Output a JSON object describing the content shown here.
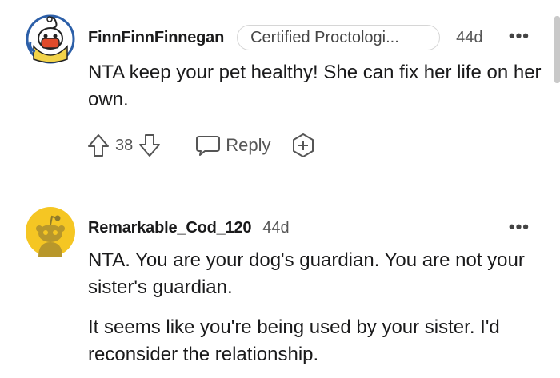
{
  "comments": [
    {
      "username": "FinnFinnFinnegan",
      "flair": "Certified Proctologi...",
      "age": "44d",
      "more_label": "•••",
      "body": [
        "NTA keep your pet healthy! She can fix her life on her own."
      ],
      "votes": "38",
      "reply_label": "Reply",
      "avatar_icon": "snoo-custom-avatar-icon"
    },
    {
      "username": "Remarkable_Cod_120",
      "age": "44d",
      "more_label": "•••",
      "body": [
        "NTA. You are your dog's guardian. You are not your sister's guardian.",
        "It seems like you're being used by your sister. I'd reconsider the relationship."
      ],
      "avatar_icon": "snoo-default-avatar-icon"
    }
  ],
  "colors": {
    "default_avatar_bg": "#F5C623",
    "text": "#1a1a1b",
    "muted": "#555555"
  }
}
